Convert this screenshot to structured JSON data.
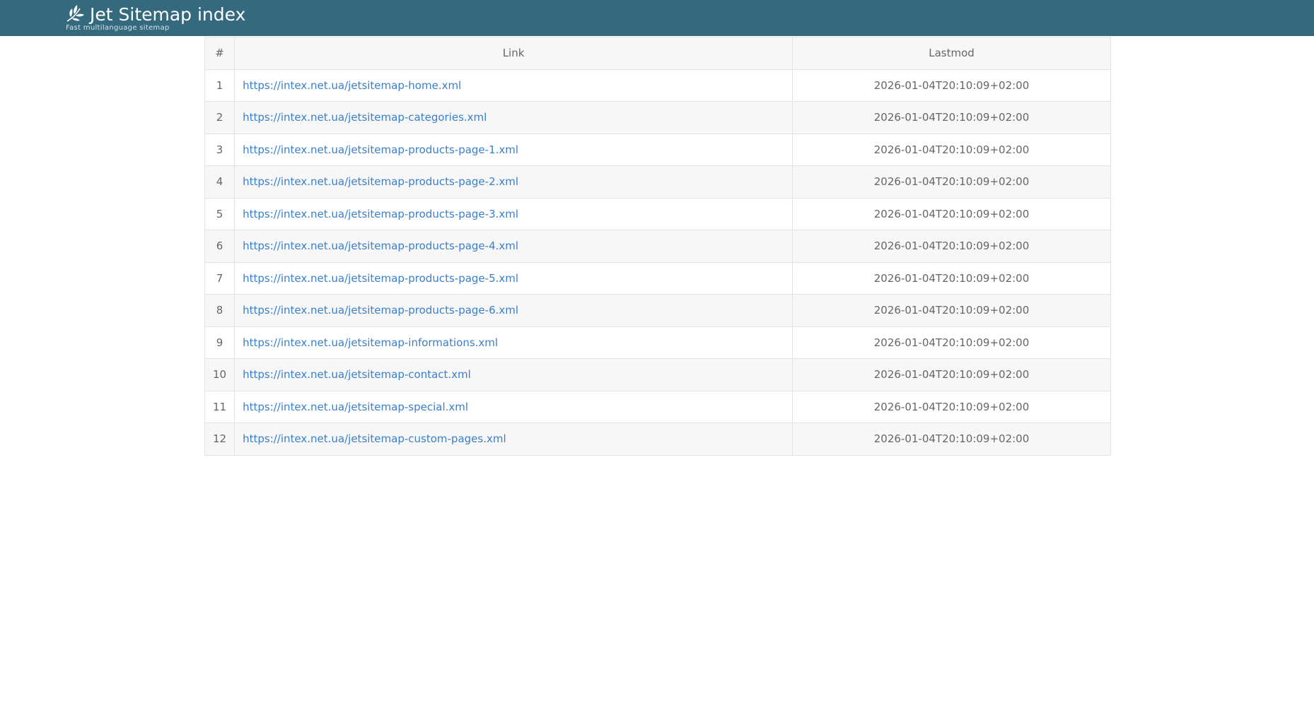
{
  "header": {
    "title": "Jet Sitemap index",
    "subtitle": "Fast multilanguage sitemap",
    "logo_icon": "leaf-branch-icon"
  },
  "table": {
    "columns": [
      "#",
      "Link",
      "Lastmod"
    ],
    "rows": [
      {
        "num": "1",
        "link": "https://intex.net.ua/jetsitemap-home.xml",
        "lastmod": "2026-01-04T20:10:09+02:00"
      },
      {
        "num": "2",
        "link": "https://intex.net.ua/jetsitemap-categories.xml",
        "lastmod": "2026-01-04T20:10:09+02:00"
      },
      {
        "num": "3",
        "link": "https://intex.net.ua/jetsitemap-products-page-1.xml",
        "lastmod": "2026-01-04T20:10:09+02:00"
      },
      {
        "num": "4",
        "link": "https://intex.net.ua/jetsitemap-products-page-2.xml",
        "lastmod": "2026-01-04T20:10:09+02:00"
      },
      {
        "num": "5",
        "link": "https://intex.net.ua/jetsitemap-products-page-3.xml",
        "lastmod": "2026-01-04T20:10:09+02:00"
      },
      {
        "num": "6",
        "link": "https://intex.net.ua/jetsitemap-products-page-4.xml",
        "lastmod": "2026-01-04T20:10:09+02:00"
      },
      {
        "num": "7",
        "link": "https://intex.net.ua/jetsitemap-products-page-5.xml",
        "lastmod": "2026-01-04T20:10:09+02:00"
      },
      {
        "num": "8",
        "link": "https://intex.net.ua/jetsitemap-products-page-6.xml",
        "lastmod": "2026-01-04T20:10:09+02:00"
      },
      {
        "num": "9",
        "link": "https://intex.net.ua/jetsitemap-informations.xml",
        "lastmod": "2026-01-04T20:10:09+02:00"
      },
      {
        "num": "10",
        "link": "https://intex.net.ua/jetsitemap-contact.xml",
        "lastmod": "2026-01-04T20:10:09+02:00"
      },
      {
        "num": "11",
        "link": "https://intex.net.ua/jetsitemap-special.xml",
        "lastmod": "2026-01-04T20:10:09+02:00"
      },
      {
        "num": "12",
        "link": "https://intex.net.ua/jetsitemap-custom-pages.xml",
        "lastmod": "2026-01-04T20:10:09+02:00"
      }
    ]
  }
}
